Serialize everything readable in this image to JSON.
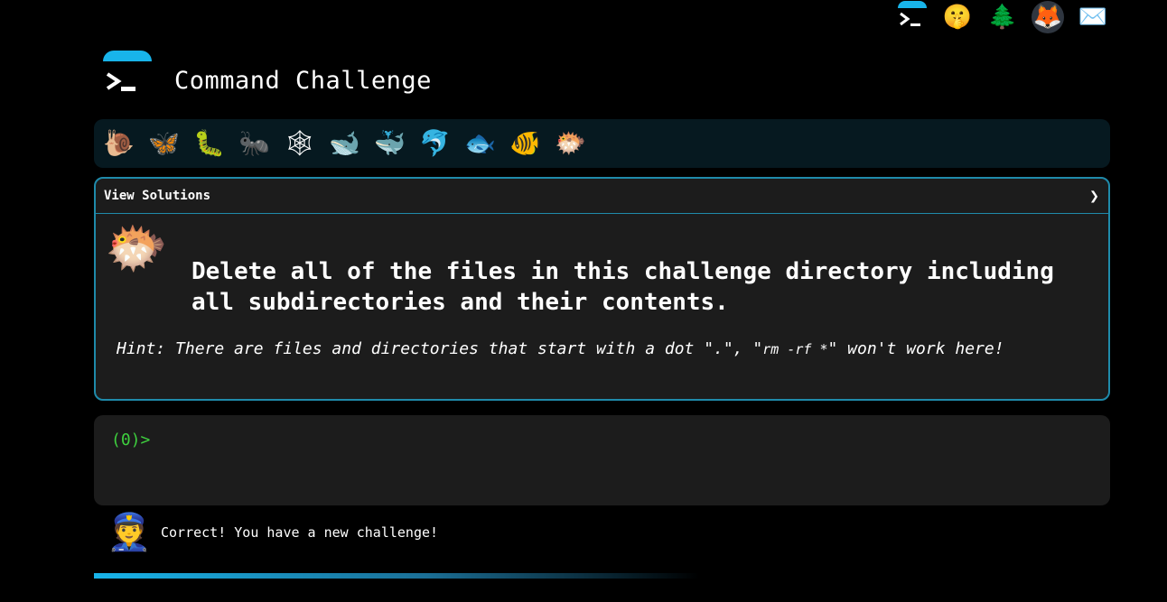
{
  "header": {
    "title": "Command Challenge"
  },
  "top_icons": [
    {
      "name": "terminal-icon",
      "glyph": ""
    },
    {
      "name": "shushing-face-icon",
      "glyph": "🤫"
    },
    {
      "name": "evergreen-tree-icon",
      "glyph": "🌲"
    },
    {
      "name": "gitlab-icon",
      "glyph": "🦊"
    },
    {
      "name": "envelope-icon",
      "glyph": "✉️"
    }
  ],
  "levels": [
    {
      "name": "level-snail-icon",
      "glyph": "🐌"
    },
    {
      "name": "level-butterfly-icon",
      "glyph": "🦋"
    },
    {
      "name": "level-caterpillar-icon",
      "glyph": "🐛"
    },
    {
      "name": "level-ant-icon",
      "glyph": "🐜"
    },
    {
      "name": "level-spider-web-icon",
      "glyph": "🕸"
    },
    {
      "name": "level-whale-icon",
      "glyph": "🐋"
    },
    {
      "name": "level-spouting-whale-icon",
      "glyph": "🐳"
    },
    {
      "name": "level-dolphin-icon",
      "glyph": "🐬"
    },
    {
      "name": "level-fish-icon",
      "glyph": "🐟"
    },
    {
      "name": "level-tropical-fish-icon",
      "glyph": "🐠"
    },
    {
      "name": "level-blowfish-icon",
      "glyph": "🐡"
    }
  ],
  "challenge": {
    "view_solutions": "View Solutions",
    "chevron": "❯",
    "emoji": "🐡",
    "text": "Delete all of the files in this challenge directory including all subdirectories and their contents.",
    "hint_prefix": "Hint: There are files and directories that start with a dot \".\", \"",
    "hint_code": "rm -rf *",
    "hint_suffix": "\" won't work here!"
  },
  "terminal": {
    "prompt": "(0)>"
  },
  "feedback": {
    "avatar": "👮",
    "message": "Correct! You have a new challenge!"
  },
  "progress": {
    "percent": 60
  },
  "colors": {
    "accent": "#18b4ea",
    "card_border": "#1f8aaa",
    "prompt_green": "#3ecf3e",
    "panel_bg": "#1c1c1c",
    "level_bar_bg": "#061920"
  }
}
